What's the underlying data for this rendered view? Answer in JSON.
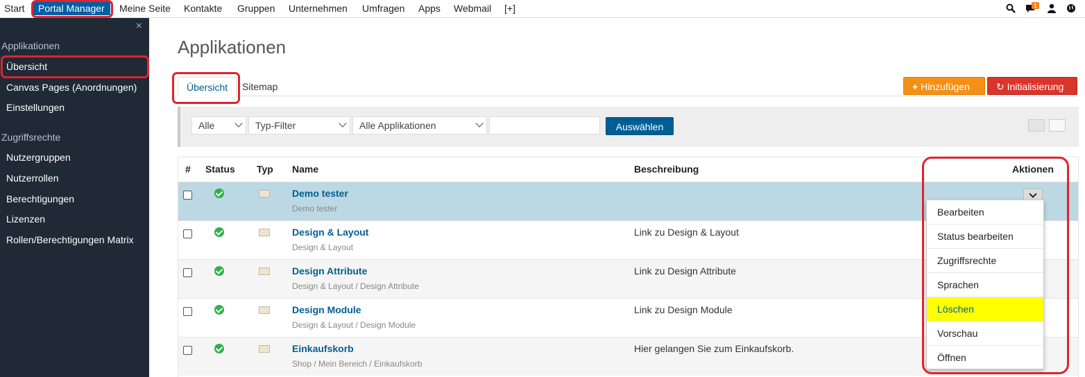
{
  "topnav": {
    "items": [
      "Start",
      "Portal Manager",
      "Meine Seite",
      "Kontakte",
      "Gruppen",
      "Unternehmen",
      "Umfragen",
      "Apps",
      "Webmail",
      "[+]"
    ],
    "notification_count": "1",
    "icons": [
      "search-icon",
      "comment-icon",
      "user-icon",
      "globe-icon"
    ]
  },
  "sidebar": {
    "close": "×",
    "section1": "Applikationen",
    "items1": [
      "Übersicht",
      "Canvas Pages (Anordnungen)",
      "Einstellungen"
    ],
    "section2": "Zugriffsrechte",
    "items2": [
      "Nutzergruppen",
      "Nutzerrollen",
      "Berechtigungen",
      "Lizenzen",
      "Rollen/Berechtigungen Matrix"
    ]
  },
  "main": {
    "title": "Applikationen",
    "tabs": [
      "Übersicht",
      "Sitemap"
    ],
    "add_button": "Hinzufügen",
    "init_button": "Initialisierung"
  },
  "filters": {
    "status": "Alle",
    "type": "Typ-Filter",
    "apps": "Alle Applikationen",
    "search_value": "",
    "submit": "Auswählen"
  },
  "table": {
    "headers": [
      "#",
      "Status",
      "Typ",
      "Name",
      "Beschreibung",
      "Aktionen"
    ],
    "rows": [
      {
        "name": "Demo tester",
        "path": "Demo tester",
        "desc": ""
      },
      {
        "name": "Design & Layout",
        "path": "Design & Layout",
        "desc": "Link zu Design & Layout"
      },
      {
        "name": "Design Attribute",
        "path": "Design & Layout / Design Attribute",
        "desc": "Link zu Design Attribute"
      },
      {
        "name": "Design Module",
        "path": "Design & Layout / Design Module",
        "desc": "Link zu Design Module"
      },
      {
        "name": "Einkaufskorb",
        "path": "Shop / Mein Bereich / Einkaufskorb",
        "desc": "Hier gelangen Sie zum Einkaufskorb."
      }
    ]
  },
  "actions_menu": {
    "items": [
      "Bearbeiten",
      "Status bearbeiten",
      "Zugriffsrechte",
      "Sprachen",
      "Löschen",
      "Vorschau",
      "Öffnen"
    ],
    "highlighted": "Löschen"
  },
  "colors": {
    "active_nav": "#005fa3",
    "sidebar_bg": "#1f2a36",
    "orange": "#f39015",
    "red": "#d9352b",
    "blue_button": "#005e96",
    "link": "#005f8f",
    "selected_row": "#bcd8e2",
    "highlight": "#ffff00",
    "annotation": "#e0232f"
  }
}
